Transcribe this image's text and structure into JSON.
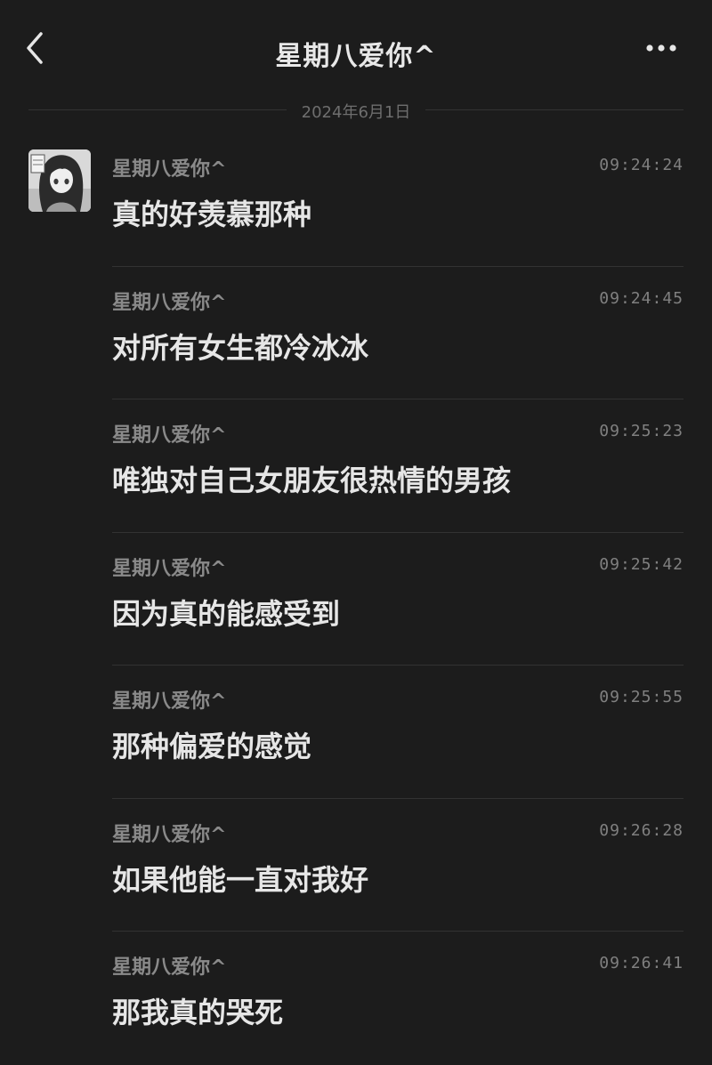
{
  "header": {
    "title": "星期八爱你^",
    "back_icon": "chevron-left-icon",
    "more_icon": "ellipsis-horizontal-icon"
  },
  "date_divider": "2024年6月1日",
  "messages": [
    {
      "sender": "星期八爱你^",
      "time": "09:24:24",
      "text": "真的好羡慕那种"
    },
    {
      "sender": "星期八爱你^",
      "time": "09:24:45",
      "text": "对所有女生都冷冰冰"
    },
    {
      "sender": "星期八爱你^",
      "time": "09:25:23",
      "text": "唯独对自己女朋友很热情的男孩"
    },
    {
      "sender": "星期八爱你^",
      "time": "09:25:42",
      "text": "因为真的能感受到"
    },
    {
      "sender": "星期八爱你^",
      "time": "09:25:55",
      "text": "那种偏爱的感觉"
    },
    {
      "sender": "星期八爱你^",
      "time": "09:26:28",
      "text": "如果他能一直对我好"
    },
    {
      "sender": "星期八爱你^",
      "time": "09:26:41",
      "text": "那我真的哭死"
    }
  ],
  "colors": {
    "background": "#1c1c1c",
    "text_primary": "#e6e6e6",
    "text_secondary": "#8a8a8a",
    "divider": "#323232"
  }
}
